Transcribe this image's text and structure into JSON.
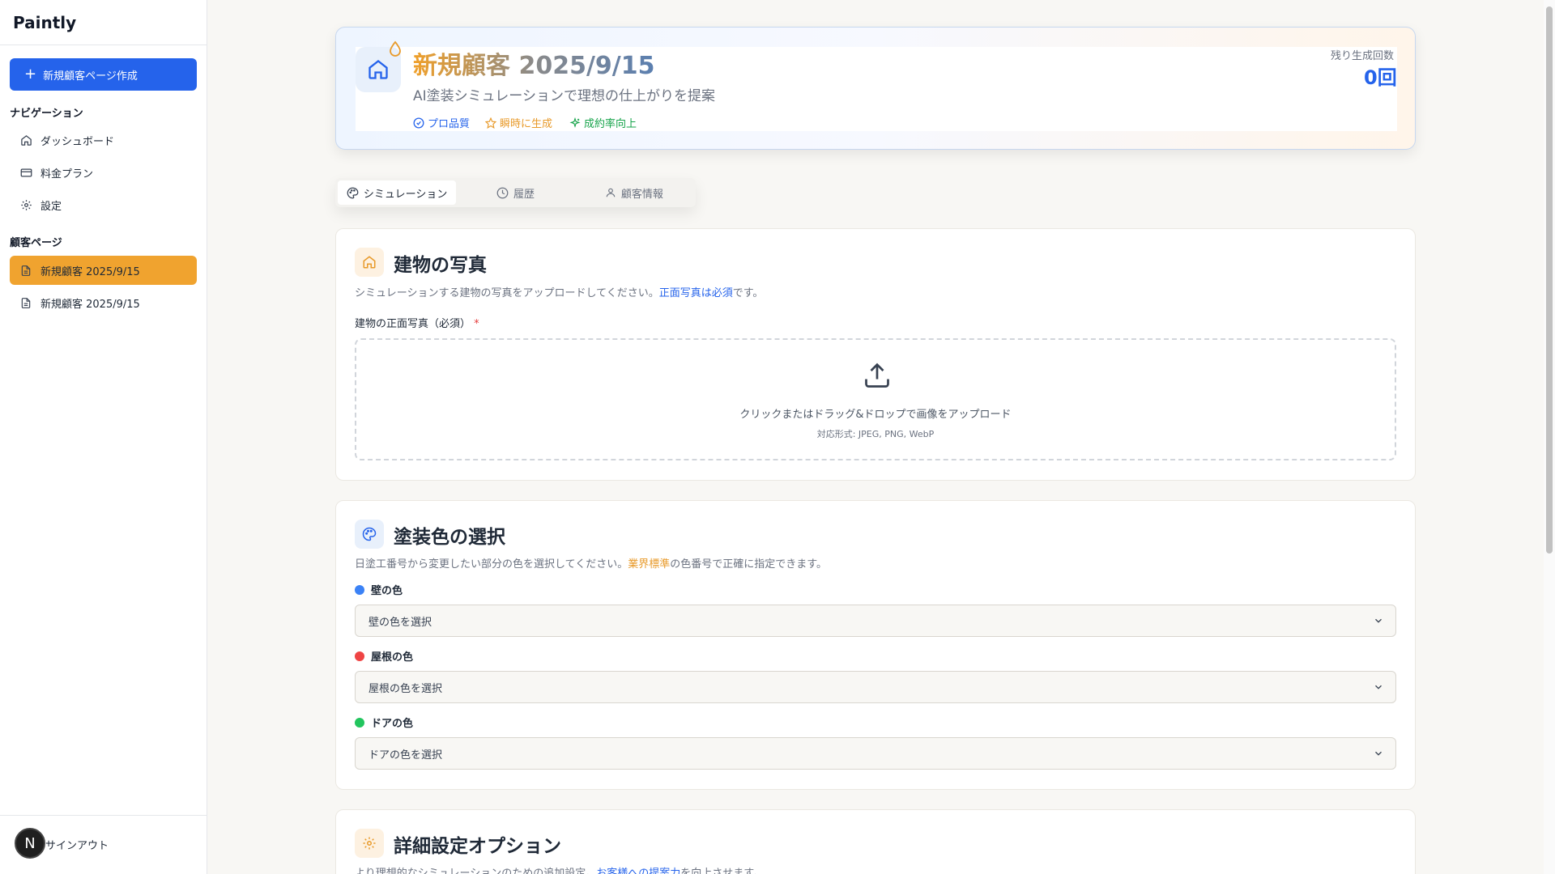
{
  "app": {
    "name": "Paintly"
  },
  "sidebar": {
    "new_button": "新規顧客ページ作成",
    "nav_heading": "ナビゲーション",
    "nav_items": [
      {
        "label": "ダッシュボード",
        "icon": "home-icon"
      },
      {
        "label": "料金プラン",
        "icon": "credit-card-icon"
      },
      {
        "label": "設定",
        "icon": "gear-icon"
      }
    ],
    "customer_heading": "顧客ページ",
    "customer_pages": [
      {
        "label": "新規顧客 2025/9/15",
        "active": true
      },
      {
        "label": "新規顧客 2025/9/15",
        "active": false
      }
    ],
    "avatar_initial": "N",
    "signout": "サインアウト"
  },
  "header": {
    "title": "新規顧客 2025/9/15",
    "subtitle": "AI塗装シミュレーションで理想の仕上がりを提案",
    "badges": [
      {
        "label": "プロ品質",
        "color": "#2563eb",
        "icon": "check-circle-icon"
      },
      {
        "label": "瞬時に生成",
        "color": "#e89a2a",
        "icon": "star-icon"
      },
      {
        "label": "成約率向上",
        "color": "#16a34a",
        "icon": "sparkles-icon"
      }
    ],
    "remaining_label": "残り生成回数",
    "remaining_value": "0回"
  },
  "tabs": [
    {
      "label": "シミュレーション",
      "icon": "palette-icon",
      "active": true
    },
    {
      "label": "履歴",
      "icon": "clock-icon",
      "active": false
    },
    {
      "label": "顧客情報",
      "icon": "user-icon",
      "active": false
    }
  ],
  "photo_section": {
    "title": "建物の写真",
    "desc_prefix": "シミュレーションする建物の写真をアップロードしてください。",
    "desc_highlight": "正面写真は必須",
    "desc_suffix": "です。",
    "field_label": "建物の正面写真（必須）",
    "required_mark": "*",
    "dropzone_text": "クリックまたはドラッグ&ドロップで画像をアップロード",
    "dropzone_hint": "対応形式: JPEG, PNG, WebP"
  },
  "color_section": {
    "title": "塗装色の選択",
    "desc_prefix": "日塗工番号から変更したい部分の色を選択してください。",
    "desc_highlight": "業界標準",
    "desc_suffix": "の色番号で正確に指定できます。",
    "fields": [
      {
        "label": "壁の色",
        "placeholder": "壁の色を選択",
        "color": "#3b82f6"
      },
      {
        "label": "屋根の色",
        "placeholder": "屋根の色を選択",
        "color": "#ef4444"
      },
      {
        "label": "ドアの色",
        "placeholder": "ドアの色を選択",
        "color": "#22c55e"
      }
    ]
  },
  "advanced_section": {
    "title": "詳細設定オプション",
    "desc_prefix": "より理想的なシミュレーションのための追加設定。",
    "desc_highlight": "お客様への提案力",
    "desc_suffix": "を向上させます。"
  }
}
